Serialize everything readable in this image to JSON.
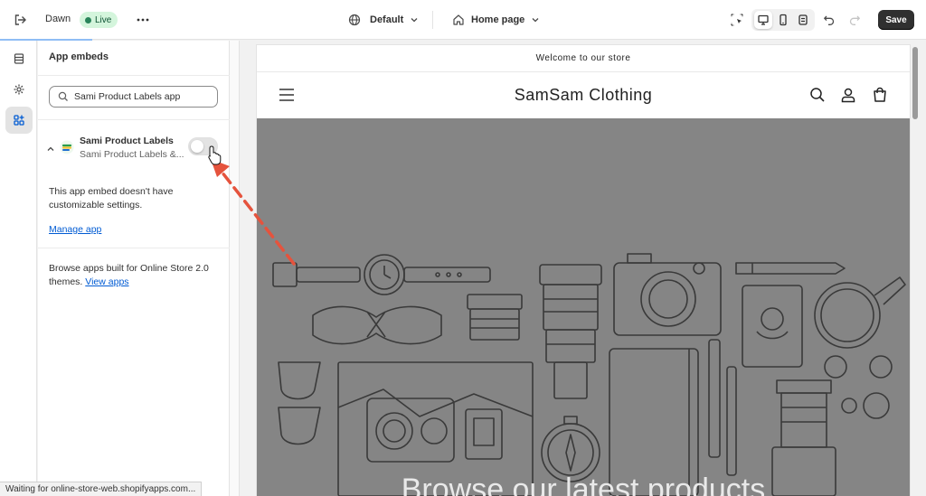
{
  "topbar": {
    "theme_name": "Dawn",
    "live_badge": "Live",
    "template_select": "Default",
    "page_select": "Home page",
    "save_label": "Save",
    "icons": [
      "exit-icon",
      "more-icon",
      "globe-icon",
      "home-icon",
      "chevron-down-icon",
      "inspector-icon",
      "desktop-icon",
      "mobile-icon",
      "fullscreen-icon",
      "undo-icon",
      "redo-icon"
    ]
  },
  "sidebar_rail": {
    "items": [
      {
        "icon": "sections-icon"
      },
      {
        "icon": "gear-icon"
      },
      {
        "icon": "app-embeds-icon",
        "active": true
      }
    ]
  },
  "panel": {
    "title": "App embeds",
    "search": {
      "value": "Sami Product Labels app"
    },
    "embed": {
      "name": "Sami Product Labels",
      "subtitle": "Sami Product Labels &...",
      "enabled": false
    },
    "no_settings_note": "This app embed doesn't have customizable settings.",
    "manage_link": "Manage app",
    "browse_note": "Browse apps built for Online Store 2.0 themes.",
    "view_apps_link": "View apps"
  },
  "preview": {
    "announcement": "Welcome to our store",
    "store_name": "SamSam Clothing",
    "hero_heading": "Browse our latest products"
  },
  "status_bar": {
    "text": "Waiting for online-store-web.shopifyapps.com..."
  },
  "colors": {
    "primary_button": "#303030",
    "link": "#005bd3",
    "live_badge_bg": "#d4f5dc",
    "hero_bg": "#858585",
    "annotation_arrow": "#e5533d"
  }
}
